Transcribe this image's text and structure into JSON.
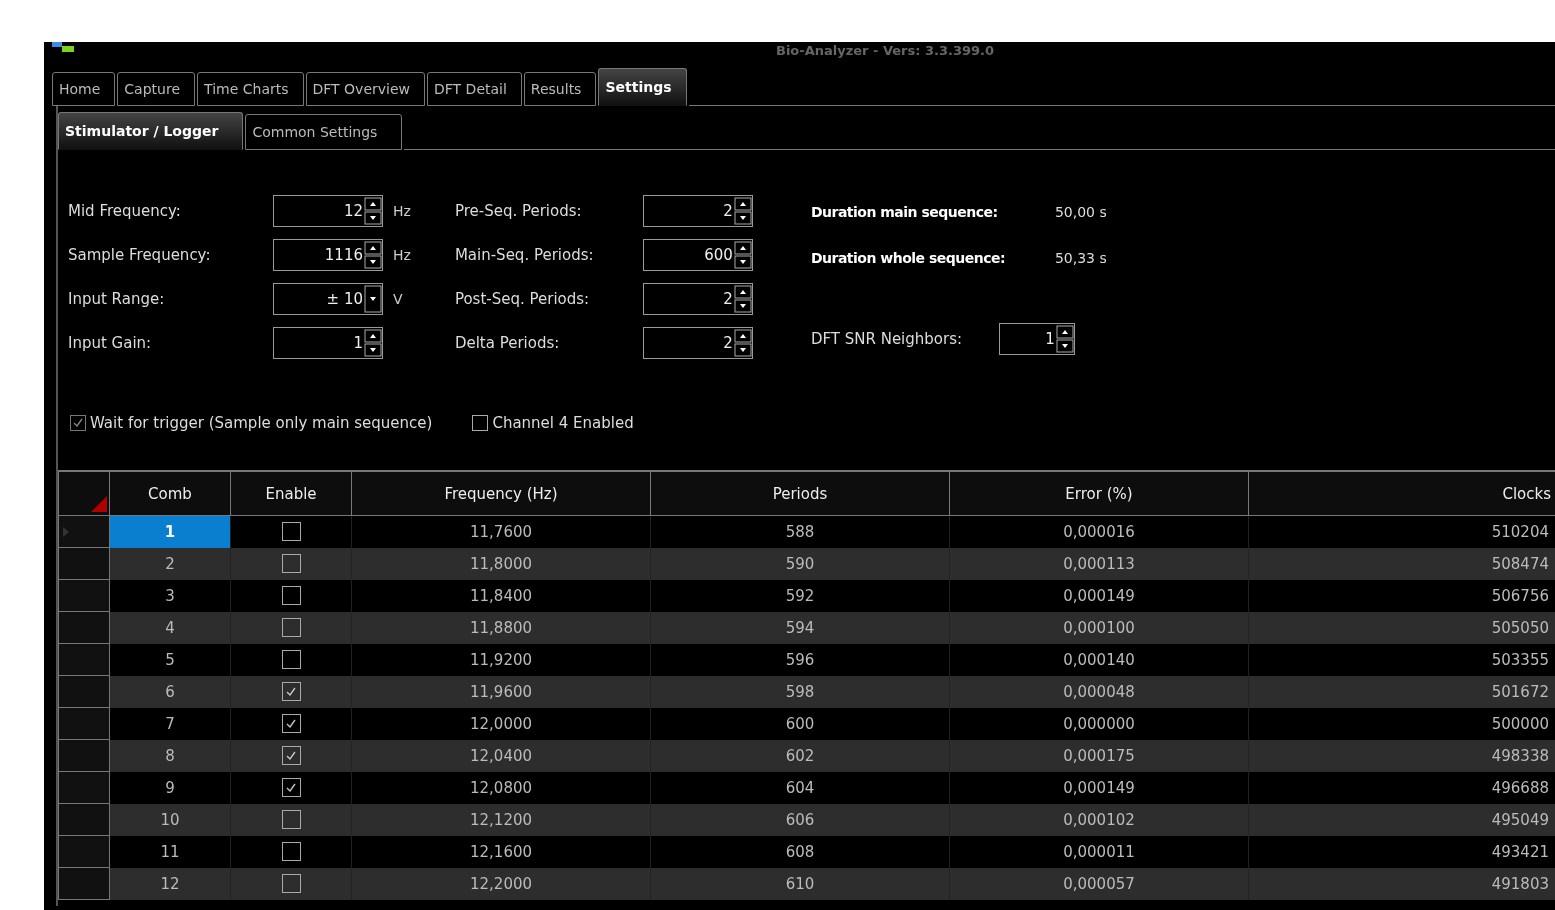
{
  "window": {
    "title": "Bio-Analyzer - Vers: 3.3.399.0"
  },
  "tabs": [
    {
      "label": "Home",
      "selected": false
    },
    {
      "label": "Capture",
      "selected": false
    },
    {
      "label": "Time Charts",
      "selected": false
    },
    {
      "label": "DFT Overview",
      "selected": false
    },
    {
      "label": "DFT Detail",
      "selected": false
    },
    {
      "label": "Results",
      "selected": false
    },
    {
      "label": "Settings",
      "selected": true
    }
  ],
  "subtabs": [
    {
      "label": "Stimulator / Logger",
      "selected": true
    },
    {
      "label": "Common Settings",
      "selected": false
    }
  ],
  "left_fields": [
    {
      "label": "Mid Frequency:",
      "value": "12",
      "kind": "spin",
      "unit": "Hz"
    },
    {
      "label": "Sample Frequency:",
      "value": "1116",
      "kind": "spin",
      "unit": "Hz"
    },
    {
      "label": "Input Range:",
      "value": "± 10",
      "kind": "dropdown",
      "unit": "V"
    },
    {
      "label": "Input Gain:",
      "value": "1",
      "kind": "spin"
    }
  ],
  "mid_fields": [
    {
      "label": "Pre-Seq. Periods:",
      "value": "2"
    },
    {
      "label": "Main-Seq. Periods:",
      "value": "600"
    },
    {
      "label": "Post-Seq. Periods:",
      "value": "2"
    },
    {
      "label": "Delta Periods:",
      "value": "2"
    }
  ],
  "durations": [
    {
      "label": "Duration main sequence:",
      "value": "50,00 s"
    },
    {
      "label": "Duration whole sequence:",
      "value": "50,33 s"
    }
  ],
  "snr": {
    "label": "DFT SNR Neighbors:",
    "value": "1"
  },
  "checkboxes": [
    {
      "label": "Wait for trigger (Sample only main sequence)",
      "checked": true,
      "disabled": true
    },
    {
      "label": "Channel 4 Enabled",
      "checked": false,
      "disabled": false
    }
  ],
  "table": {
    "columns": [
      "Comb",
      "Enable",
      "Frequency (Hz)",
      "Periods",
      "Error (%)",
      "Clocks"
    ],
    "rows": [
      {
        "comb": "1",
        "enabled": false,
        "frequency": "11,7600",
        "periods": "588",
        "error": "0,000016",
        "clocks": "510204",
        "selected": true
      },
      {
        "comb": "2",
        "enabled": false,
        "frequency": "11,8000",
        "periods": "590",
        "error": "0,000113",
        "clocks": "508474",
        "selected": false
      },
      {
        "comb": "3",
        "enabled": false,
        "frequency": "11,8400",
        "periods": "592",
        "error": "0,000149",
        "clocks": "506756",
        "selected": false
      },
      {
        "comb": "4",
        "enabled": false,
        "frequency": "11,8800",
        "periods": "594",
        "error": "0,000100",
        "clocks": "505050",
        "selected": false
      },
      {
        "comb": "5",
        "enabled": false,
        "frequency": "11,9200",
        "periods": "596",
        "error": "0,000140",
        "clocks": "503355",
        "selected": false
      },
      {
        "comb": "6",
        "enabled": true,
        "frequency": "11,9600",
        "periods": "598",
        "error": "0,000048",
        "clocks": "501672",
        "selected": false
      },
      {
        "comb": "7",
        "enabled": true,
        "frequency": "12,0000",
        "periods": "600",
        "error": "0,000000",
        "clocks": "500000",
        "selected": false
      },
      {
        "comb": "8",
        "enabled": true,
        "frequency": "12,0400",
        "periods": "602",
        "error": "0,000175",
        "clocks": "498338",
        "selected": false
      },
      {
        "comb": "9",
        "enabled": true,
        "frequency": "12,0800",
        "periods": "604",
        "error": "0,000149",
        "clocks": "496688",
        "selected": false
      },
      {
        "comb": "10",
        "enabled": false,
        "frequency": "12,1200",
        "periods": "606",
        "error": "0,000102",
        "clocks": "495049",
        "selected": false
      },
      {
        "comb": "11",
        "enabled": false,
        "frequency": "12,1600",
        "periods": "608",
        "error": "0,000011",
        "clocks": "493421",
        "selected": false
      },
      {
        "comb": "12",
        "enabled": false,
        "frequency": "12,2000",
        "periods": "610",
        "error": "0,000057",
        "clocks": "491803",
        "selected": false
      }
    ]
  }
}
